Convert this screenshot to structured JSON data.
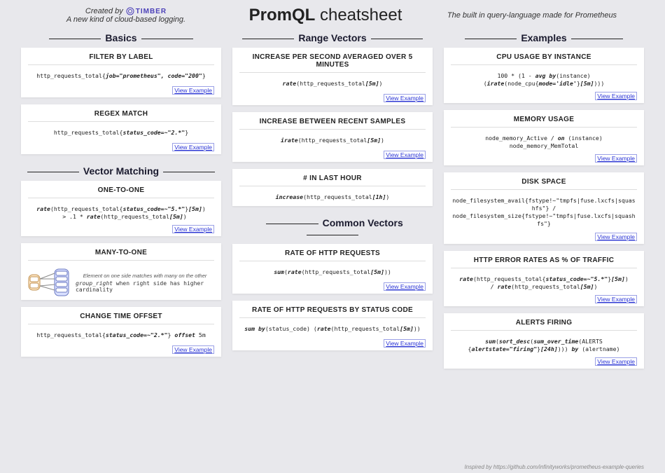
{
  "header": {
    "created_by_prefix": "Created by",
    "timber_brand": "TIMBER",
    "tagline": "A new kind of cloud-based logging.",
    "title_bold": "PromQL",
    "title_light": "cheatsheet",
    "subtitle_right": "The built in query-language made for Prometheus"
  },
  "link_label": "View Example",
  "footer": "Inspired by https://github.com/infinityworks/prometheus-example-queries",
  "col1": {
    "sectionA": "Basics",
    "cards_a": [
      {
        "title": "FILTER BY LABEL",
        "code": "http_requests_total{job=\"prometheus\", code=\"200\"}",
        "link": true
      },
      {
        "title": "REGEX MATCH",
        "code": "http_requests_total{status_code=~\"2.*\"}",
        "link": true
      }
    ],
    "sectionB": "Vector Matching",
    "cards_b": [
      {
        "title": "ONE-TO-ONE",
        "code": "rate(http_requests_total{status_code=~\"5.*\"}[5m])\n  > .1 * rate(http_requests_total[5m])",
        "link": true
      },
      {
        "title": "MANY-TO-ONE",
        "diagram": true,
        "hint": "Element on one side matches with many on the other",
        "code": "group_right when right side has higher cardinality",
        "link": false
      },
      {
        "title": "CHANGE TIME OFFSET",
        "code": "http_requests_total{status_code=~\"2.*\"} offset 5m",
        "link": true
      }
    ]
  },
  "col2": {
    "sectionA": "Range Vectors",
    "cards_a": [
      {
        "title": "INCREASE PER SECOND AVERAGED OVER 5 MINUTES",
        "code": "rate(http_requests_total[5m])",
        "link": true
      },
      {
        "title": "INCREASE BETWEEN RECENT SAMPLES",
        "code": "irate(http_requests_total[5m])",
        "link": true
      },
      {
        "title": "# IN LAST HOUR",
        "code": "increase(http_requests_total[1h])",
        "link": false
      }
    ],
    "sectionB": "Common Vectors",
    "cards_b": [
      {
        "title": "RATE OF HTTP REQUESTS",
        "code": "sum(rate(http_requests_total[5m]))",
        "link": true
      },
      {
        "title": "RATE OF HTTP REQUESTS BY STATUS CODE",
        "code": "sum by(status_code) (rate(http_requests_total[5m]))",
        "link": true
      }
    ]
  },
  "col3": {
    "sectionA": "Examples",
    "cards_a": [
      {
        "title": "CPU USAGE BY INSTANCE",
        "code": "100 * (1 - avg by(instance)\n(irate(node_cpu{mode='idle'}[5m])))",
        "link": true
      },
      {
        "title": "MEMORY USAGE",
        "code": "node_memory_Active / on (instance) node_memory_MemTotal",
        "link": true
      },
      {
        "title": "DISK SPACE",
        "code": "node_filesystem_avail{fstype!~\"tmpfs|fuse.lxcfs|squashfs\"} /\nnode_filesystem_size{fstype!~\"tmpfs|fuse.lxcfs|squashfs\"}",
        "link": true
      },
      {
        "title": "HTTP ERROR RATES AS % OF TRAFFIC",
        "code": "rate(http_requests_total{status_code=~\"5.*\"}[5m])\n/ rate(http_requests_total[5m])",
        "link": true
      },
      {
        "title": "ALERTS FIRING",
        "code": "sum(sort_desc(sum_over_time(ALERTS\n{alertstate=\"firing\"}[24h]))) by (alertname)",
        "link": true
      }
    ]
  }
}
